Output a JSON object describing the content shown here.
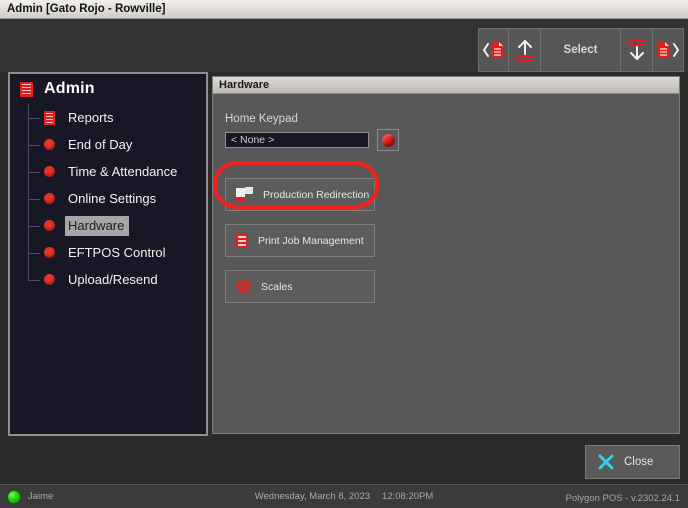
{
  "window": {
    "title": "Admin [Gato Rojo - Rowville]"
  },
  "toolbar": {
    "prev_icon": "document-previous-icon",
    "up_icon": "arrow-up-icon",
    "select_label": "Select",
    "down_icon": "arrow-down-icon",
    "next_icon": "document-next-icon"
  },
  "sidebar": {
    "root": {
      "label": "Admin",
      "icon": "red-document-icon"
    },
    "items": [
      {
        "label": "Reports",
        "icon": "red-document-icon",
        "selected": false
      },
      {
        "label": "End of Day",
        "icon": "red-dot-icon",
        "selected": false
      },
      {
        "label": "Time & Attendance",
        "icon": "red-dot-icon",
        "selected": false
      },
      {
        "label": "Online Settings",
        "icon": "red-dot-icon",
        "selected": false
      },
      {
        "label": "Hardware",
        "icon": "red-dot-icon",
        "selected": true
      },
      {
        "label": "EFTPOS Control",
        "icon": "red-dot-icon",
        "selected": false
      },
      {
        "label": "Upload/Resend",
        "icon": "red-dot-icon",
        "selected": false
      }
    ]
  },
  "content": {
    "header": "Hardware",
    "home_keypad": {
      "label": "Home Keypad",
      "value": "< None >",
      "button_icon": "red-circle-icon"
    },
    "actions": [
      {
        "label": "Production Redirection",
        "icon": "production-redirection-icon",
        "highlighted": true
      },
      {
        "label": "Print Job Management",
        "icon": "print-job-icon",
        "highlighted": false
      },
      {
        "label": "Scales",
        "icon": "gear-icon",
        "highlighted": false
      }
    ]
  },
  "footer": {
    "close_label": "Close",
    "close_icon": "close-x-icon"
  },
  "statusbar": {
    "user": "Jaime",
    "user_status_icon": "green-led-icon",
    "date": "Wednesday, March  8, 2023",
    "time": "12:08:20PM",
    "version": "Polygon POS - v.2302.24.1"
  },
  "colors": {
    "accent_red": "#e02020",
    "annotation_red": "#f42121",
    "close_cyan": "#2fd2e8",
    "status_green": "#1fd40e"
  }
}
